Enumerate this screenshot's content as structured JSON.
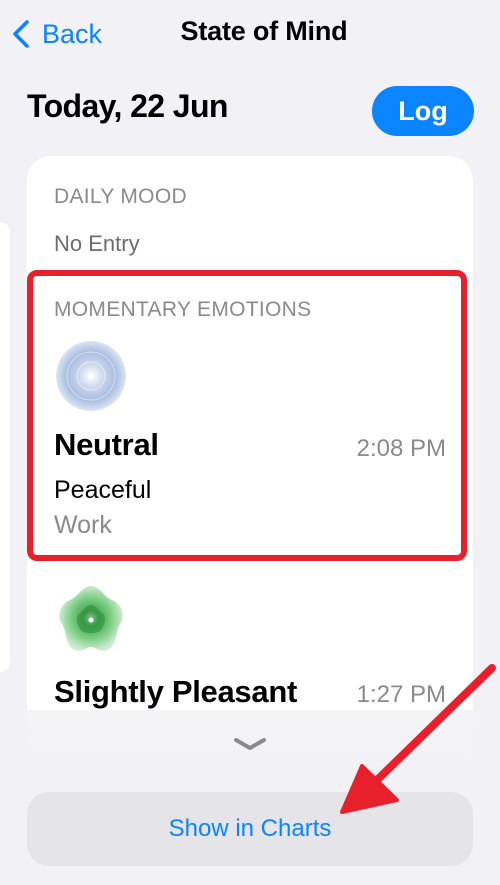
{
  "nav": {
    "back_label": "Back",
    "title": "State of Mind"
  },
  "header": {
    "date": "Today, 22 Jun",
    "log_label": "Log"
  },
  "daily_mood": {
    "label": "DAILY MOOD",
    "value": "No Entry"
  },
  "momentary": {
    "label": "MOMENTARY EMOTIONS",
    "entries": [
      {
        "mood": "Neutral",
        "time": "2:08 PM",
        "feeling": "Peaceful",
        "context": "Work",
        "icon": "neutral-mood-icon"
      },
      {
        "mood": "Slightly Pleasant",
        "time": "1:27 PM",
        "icon": "pleasant-mood-icon"
      }
    ]
  },
  "footer": {
    "charts_label": "Show in Charts"
  },
  "colors": {
    "accent": "#0a84ff",
    "highlight": "#e8202c",
    "arrow": "#e8202c"
  }
}
